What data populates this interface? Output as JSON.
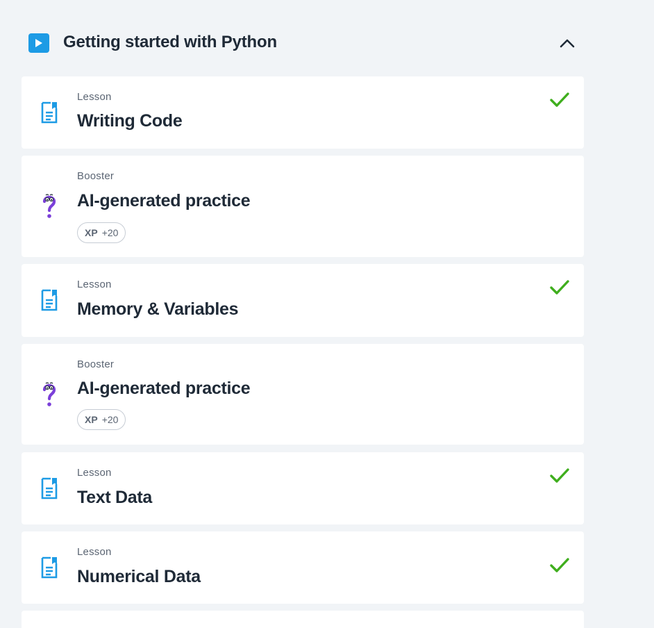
{
  "section": {
    "title": "Getting started with Python",
    "icons": {
      "play": "play-icon",
      "collapse": "chevron-up-icon"
    },
    "colors": {
      "accent": "#1d9be5",
      "check": "#3fae1d",
      "booster": "#7b3fd9"
    }
  },
  "items": [
    {
      "kind": "Lesson",
      "title": "Writing Code",
      "icon": "lesson-document-icon",
      "completed": true
    },
    {
      "kind": "Booster",
      "title": "AI-generated practice",
      "icon": "question-mark-booster-icon",
      "completed": false,
      "xp_label": "XP",
      "xp_value": "+20"
    },
    {
      "kind": "Lesson",
      "title": "Memory & Variables",
      "icon": "lesson-document-icon",
      "completed": true
    },
    {
      "kind": "Booster",
      "title": "AI-generated practice",
      "icon": "question-mark-booster-icon",
      "completed": false,
      "xp_label": "XP",
      "xp_value": "+20"
    },
    {
      "kind": "Lesson",
      "title": "Text Data",
      "icon": "lesson-document-icon",
      "completed": true
    },
    {
      "kind": "Lesson",
      "title": "Numerical Data",
      "icon": "lesson-document-icon",
      "completed": true
    }
  ]
}
